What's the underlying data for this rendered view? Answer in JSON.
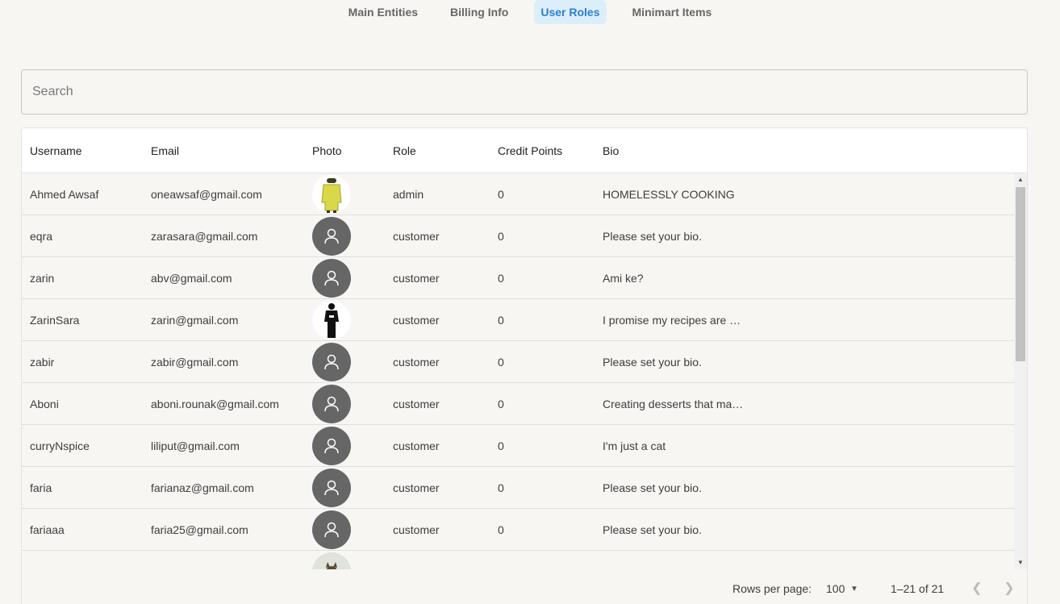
{
  "tabs": [
    {
      "label": "Main Entities",
      "active": false
    },
    {
      "label": "Billing Info",
      "active": false
    },
    {
      "label": "User Roles",
      "active": true
    },
    {
      "label": "Minimart Items",
      "active": false
    }
  ],
  "search": {
    "placeholder": "Search"
  },
  "table": {
    "columns": [
      "Username",
      "Email",
      "Photo",
      "Role",
      "Credit Points",
      "Bio"
    ],
    "rows": [
      {
        "username": "Ahmed Awsaf",
        "email": "oneawsaf@gmail.com",
        "photo": "photo-yellow",
        "role": "admin",
        "credit": "0",
        "bio": "HOMELESSLY COOKING"
      },
      {
        "username": "eqra",
        "email": "zarasara@gmail.com",
        "photo": "default-avatar",
        "role": "customer",
        "credit": "0",
        "bio": "Please set your bio."
      },
      {
        "username": "zarin",
        "email": "abv@gmail.com",
        "photo": "default-avatar",
        "role": "customer",
        "credit": "0",
        "bio": "Ami ke?"
      },
      {
        "username": "ZarinSara",
        "email": "zarin@gmail.com",
        "photo": "photo-black",
        "role": "customer",
        "credit": "0",
        "bio": "I promise my recipes are …"
      },
      {
        "username": "zabir",
        "email": "zabir@gmail.com",
        "photo": "default-avatar",
        "role": "customer",
        "credit": "0",
        "bio": "Please set your bio."
      },
      {
        "username": "Aboni",
        "email": "aboni.rounak@gmail.com",
        "photo": "default-avatar",
        "role": "customer",
        "credit": "0",
        "bio": "Creating desserts that ma…"
      },
      {
        "username": "curryNspice",
        "email": "liliput@gmail.com",
        "photo": "default-avatar",
        "role": "customer",
        "credit": "0",
        "bio": "I'm just a cat"
      },
      {
        "username": "faria",
        "email": "farianaz@gmail.com",
        "photo": "default-avatar",
        "role": "customer",
        "credit": "0",
        "bio": "Please set your bio."
      },
      {
        "username": "fariaaa",
        "email": "faria25@gmail.com",
        "photo": "default-avatar",
        "role": "customer",
        "credit": "0",
        "bio": "Please set your bio."
      },
      {
        "username": "",
        "email": "",
        "photo": "photo-cat",
        "role": "",
        "credit": "",
        "bio": ""
      }
    ]
  },
  "pagination": {
    "rows_per_page_label": "Rows per page:",
    "rows_per_page_value": "100",
    "range": "1–21 of 21"
  },
  "colors": {
    "accent": "#2b7fd1",
    "accent_bg": "#dceefa",
    "avatar_default": "#666666"
  }
}
